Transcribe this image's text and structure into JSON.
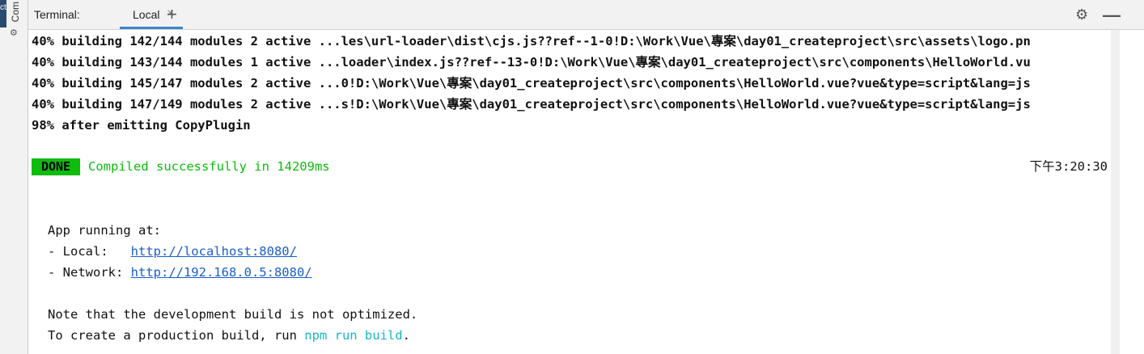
{
  "sidebar": {
    "vertical_tab": "Com",
    "blue_text": "ct"
  },
  "header": {
    "title": "Terminal:",
    "tab_label": "Local",
    "close_symbol": "×",
    "add_symbol": "+"
  },
  "output": {
    "lines": [
      "40% building 142/144 modules 2 active ...les\\url-loader\\dist\\cjs.js??ref--1-0!D:\\Work\\Vue\\專案\\day01_createproject\\src\\assets\\logo.pn",
      "40% building 143/144 modules 1 active ...loader\\index.js??ref--13-0!D:\\Work\\Vue\\專案\\day01_createproject\\src\\components\\HelloWorld.vu",
      "40% building 145/147 modules 2 active ...0!D:\\Work\\Vue\\專案\\day01_createproject\\src\\components\\HelloWorld.vue?vue&type=script&lang=js",
      "40% building 147/149 modules 2 active ...s!D:\\Work\\Vue\\專案\\day01_createproject\\src\\components\\HelloWorld.vue?vue&type=script&lang=js",
      "98% after emitting CopyPlugin"
    ],
    "done_badge": "DONE",
    "done_message": "Compiled successfully in 14209ms",
    "timestamp": "下午3:20:30",
    "app_running": "App running at:",
    "local_label": "- Local:   ",
    "local_url": "http://localhost:8080/",
    "network_label": "- Network: ",
    "network_url": "http://192.168.0.5:8080/",
    "note": "Note that the development build is not optimized.",
    "prod_prefix": "To create a production build, run ",
    "prod_cmd": "npm run build",
    "prod_suffix": "."
  }
}
